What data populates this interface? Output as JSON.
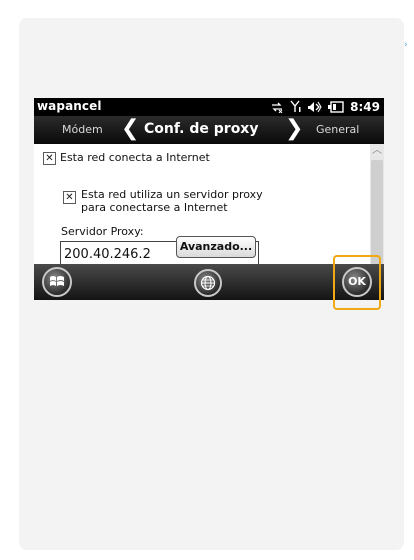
{
  "status_bar": {
    "app_title": "wapancel",
    "time": "8:49",
    "icons": [
      "network-icon",
      "signal-icon",
      "volume-icon",
      "battery-icon"
    ]
  },
  "nav": {
    "prev_label": "Módem",
    "title": "Conf. de proxy",
    "next_label": "General"
  },
  "content": {
    "internet_checkbox": {
      "label": "Esta red conecta a Internet",
      "checked": true
    },
    "proxy_checkbox": {
      "label_line1": "Esta red utiliza un servidor proxy",
      "label_line2": "para conectarse a Internet",
      "checked": true
    },
    "proxy_server_label": "Servidor Proxy:",
    "proxy_server_value": "200.40.246.2",
    "advanced_button": "Avanzado..."
  },
  "bottom_bar": {
    "start_icon": "windows-start-icon",
    "internet_icon": "globe-icon",
    "ok_label": "OK"
  },
  "colors": {
    "highlight": "#f0a814",
    "accent_mark": "#4a9fd8"
  }
}
